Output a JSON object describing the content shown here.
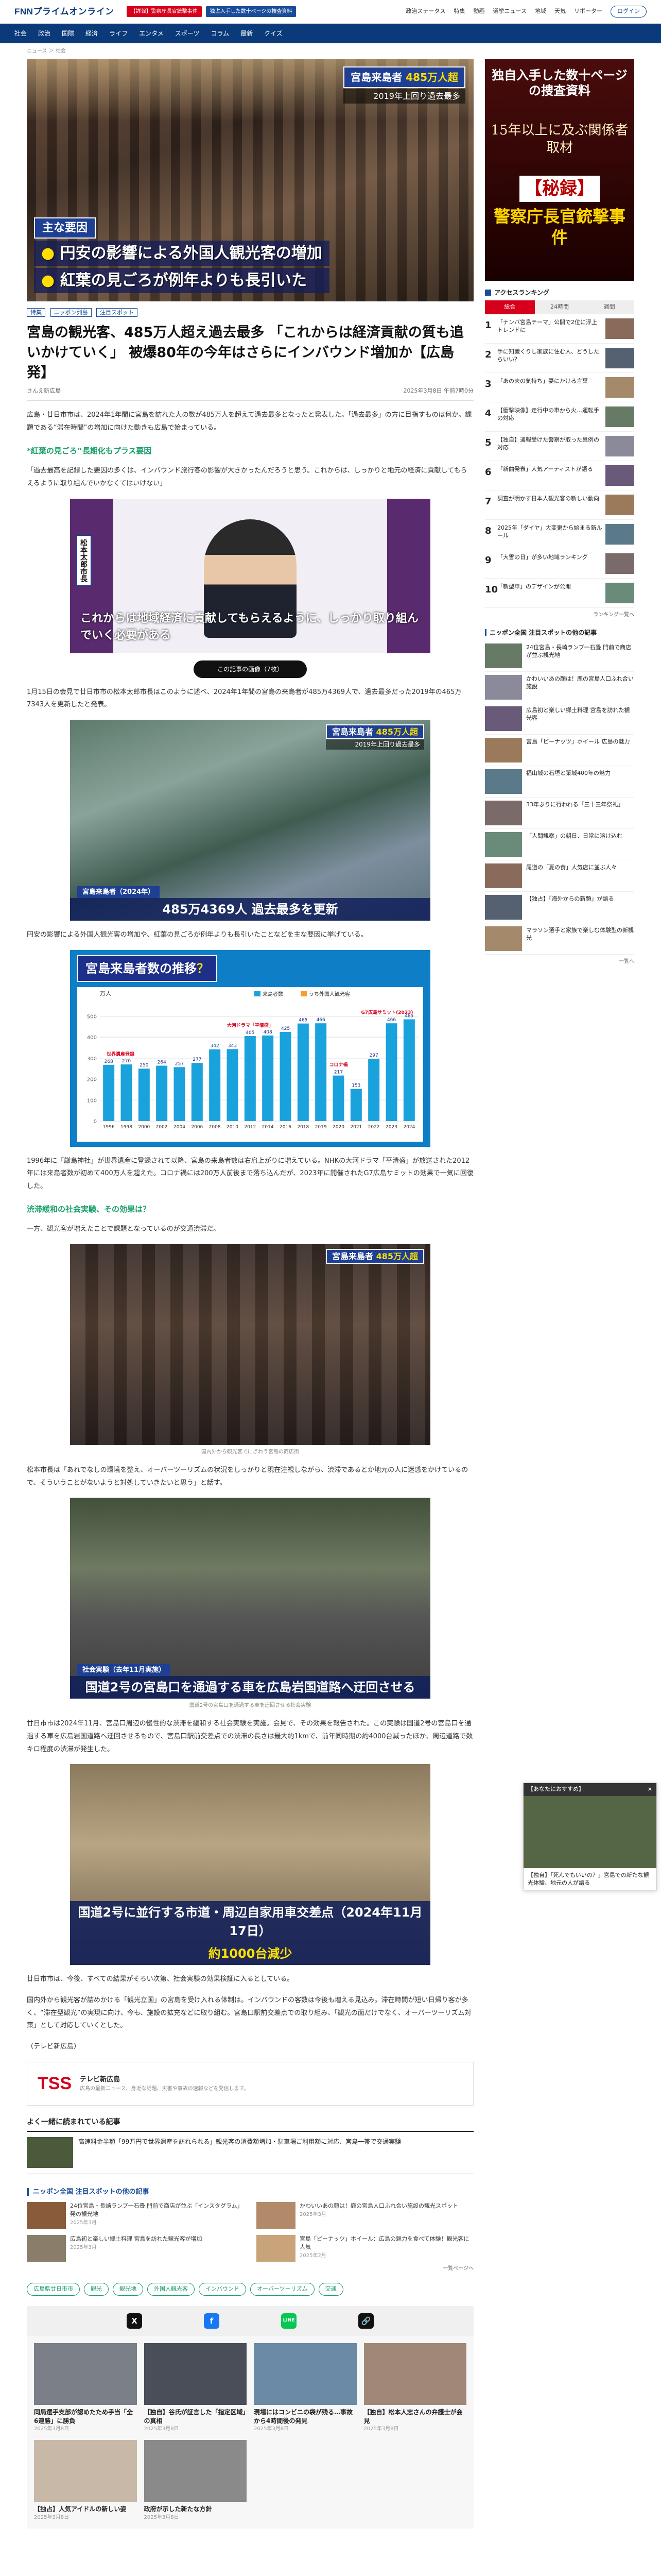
{
  "site": {
    "logo": "FNNプライムオンライン"
  },
  "header": {
    "promos": [
      "【詳報】警察庁長官銃撃事件",
      "独占入手した数十ページの捜査資料"
    ],
    "nav": [
      "政治ステータス",
      "特集",
      "動画",
      "選挙ニュース",
      "地域",
      "天気",
      "リポーター"
    ],
    "login": "ログイン"
  },
  "global_nav": [
    "社会",
    "政治",
    "国際",
    "経済",
    "ライフ",
    "エンタメ",
    "スポーツ",
    "コラム",
    "最新",
    "クイズ"
  ],
  "breadcrumb": "ニュース ＞ 社会",
  "hero": {
    "ch_tag": "宮島来島者",
    "ch_tag_em": "485万人超",
    "ch_tag_sub": "2019年上回り過去最多",
    "factor_label": "主な要因",
    "factors": [
      "円安の影響による外国人観光客の増加",
      "紅葉の見ごろが例年よりも長引いた"
    ]
  },
  "article": {
    "labels": [
      "特集",
      "ニッポン列島",
      "注目スポット"
    ],
    "title": "宮島の観光客、485万人超え過去最多 「これからは経済貢献の質も追いかけていく」 被爆80年の今年はさらにインバウンド増加か【広島発】",
    "author": "さんえ新広島",
    "date": "2025年3月8日 午前7時0分",
    "p1": "広島・廿日市市は、2024年1年間に宮島を訪れた人の数が485万人を超えて過去最多となったと発表した。「過去最多」の方に目指すものは何か。課題である“滞在時間”の増加に向けた動きも広島で始まっている。",
    "sub1": "*紅葉の見ごろ“長期化もプラス要因",
    "p2": "「過去最高を記録した要因の多くは、インバウンド旅行客の影響が大きかったんだろうと思う。これからは、しっかりと地元の経済に貢献してもらえるように取り組んでいかなくてはいけない」",
    "mayor_name": "松本太郎市長",
    "mayor_quote": "これからは地域経済に貢献してもらえるように、しっかり取り組んでいく必要がある",
    "photo_count": "この記事の画像（7枚）",
    "p3": "1月15日の会見で廿日市市の松本太郎市長はこのように述べ、2024年1年間の宮島の来島者が485万4369人で、過去最多だった2019年の465万7343人を更新したと発表。",
    "aerial_tag": "宮島来島者",
    "aerial_tag_em": "485万人超",
    "aerial_sub": "2019年上回り過去最多",
    "aerial_low_tag": "宮島来島者（2024年）",
    "aerial_low": "485万4369人 過去最多を更新",
    "p4": "円安の影響による外国人観光客の増加や、紅葉の見ごろが例年よりも長引いたことなどを主な要因に挙げている。",
    "p5": "1996年に「厳島神社」が世界遺産に登録されて以降、宮島の来島者数は右肩上がりに増えている。NHKの大河ドラマ「平清盛」が放送された2012年には来島者数が初めて400万人を超えた。コロナ禍には200万人前後まで落ち込んだが、2023年に開催されたG7広島サミットの効果で一気に回復した。",
    "sub2": "渋滞緩和の社会実験、その効果は？",
    "p6": "一方、観光客が増えたことで課題となっているのが交通渋滞だ。",
    "crowd_cap": "国内外から観光客でにぎわう宮島の商店街",
    "p7": "松本市長は「あれでなしの環境を整え、オーバーツーリズムの状況をしっかりと現在注視しながら、渋滞であるとか地元の人に迷惑をかけているので、そういうことがないようと対処していきたいと思う」と話す。",
    "road_tag": "社会実験",
    "road_tag_sub": "（去年11月実施）",
    "road_low": "国道2号の宮島口を通過する車を広島岩国道路へ迂回させる",
    "road_cap": "国道2号の宮島口を通過する車を迂回させる社会実験",
    "p8": "廿日市市は2024年11月、宮島口周辺の慢性的な渋滞を緩和する社会実験を実施。会見で、その効果を報告された。この実験は国道2号の宮島口を通過する車を広島岩国道路へ迂回させるもので、宮島口駅前交差点での渋滞の長さは最大約1kmで、前年同時期の約4000台減ったほか、周辺道路で数キロ程度の渋滞が発生した。",
    "survey_low": "国道2号に並行する市道・周辺自家用車交差点（2024年11月17日）",
    "survey_low2": "約1000台減少",
    "p9": "廿日市市は、今後、すべての結果がそろい次第、社会実験の効果検証に入るとしている。",
    "p10": "国内外から観光客が詰めかける「観光立国」の宮島を受け入れる体制は。インバウンドの客数は今後も増える見込み。滞在時間が短い日帰り客が多く、“滞在型観光”の実現に向け、今も、施設の拡充などに取り組む。宮島口駅前交差点での取り組み、「観光の面だけでなく、オーバーツーリズム対策」として対応していくとした。",
    "source": "（テレビ新広島）"
  },
  "chart_data": {
    "type": "bar",
    "title": "宮島来島者数の推移",
    "title_em": "？",
    "legend": [
      "来島者数",
      "うち外国人観光客"
    ],
    "categories": [
      "1996",
      "1998",
      "2000",
      "2002",
      "2004",
      "2006",
      "2008",
      "2010",
      "2012",
      "2014",
      "2016",
      "2018",
      "2019",
      "2020",
      "2021",
      "2022",
      "2023",
      "2024"
    ],
    "values": [
      268,
      270,
      250,
      264,
      257,
      277,
      342,
      343,
      405,
      408,
      425,
      465,
      466,
      217,
      153,
      297,
      466,
      485
    ],
    "annotations": [
      {
        "label": "世界遺産登録",
        "x": "1996"
      },
      {
        "label": "大河ドラマ「平清盛」",
        "x": "2012"
      },
      {
        "label": "コロナ禍",
        "x": "2020"
      },
      {
        "label": "G7広島サミット(2023)",
        "x": "2023"
      }
    ],
    "ylim": [
      0,
      550
    ],
    "ylabel": "万人"
  },
  "tss": {
    "logo": "TSS",
    "name": "テレビ新広島",
    "desc": "広島の最新ニュース、身近な話題、災害や事故の速報などを発信します。"
  },
  "read_more": {
    "heading": "よく一緒に読まれている記事",
    "item": "高速料金半額「99万円で世界遺産を訪れられる」観光客の消費額増加・駐車場ご利用額に対応、宮島一帯で交通実験"
  },
  "gn_section": {
    "heading": "ニッポン全国 注目スポットの他の記事",
    "items": [
      {
        "title": "24位宮島・長崎ランプ一石畳 門前で商店が並ぶ「インスタグラム」発の観光地",
        "date": "2025年3月"
      },
      {
        "title": "かわいいあの顔は！鹿の宮島人口ふれ合い施設の観光スポット",
        "date": "2025年3月"
      },
      {
        "title": "広島初と楽しい郷土料理 宮島を訪れた観光客が増加",
        "date": "2025年3月"
      },
      {
        "title": "宮島「ピーナッツ」ホイール：広島の魅力を食べて体験！観光客に人気",
        "date": "2025年2月"
      }
    ],
    "more": "一覧ページへ"
  },
  "tags": [
    "広島県廿日市市",
    "観光",
    "観光地",
    "外国人観光客",
    "インバウンド",
    "オーバーツーリズム",
    "交通"
  ],
  "share": [
    "X",
    "f",
    "LINE",
    "🔗"
  ],
  "bottom": [
    {
      "title": "同局選手支部が認めたため手当「全6連勝」に勝負",
      "date": "2025年3月8日"
    },
    {
      "title": "【独自】谷氏が証言した「指定区域」の真相",
      "date": "2025年3月8日"
    },
    {
      "title": "現場にはコンビニの袋が残る…事故から4時間後の発見",
      "date": "2025年3月8日"
    },
    {
      "title": "【独自】松本人志さんの弁護士が会見",
      "date": "2025年3月8日"
    },
    {
      "title": "【独占】人気アイドルの新しい姿",
      "date": "2025年3月8日"
    },
    {
      "title": "政府が示した新たな方針",
      "date": "2025年3月8日"
    }
  ],
  "sidebar": {
    "ad": {
      "a1": "独自入手した数十ページの捜査資料",
      "a2": "15年以上に及ぶ関係者取材",
      "a3": "【秘録】",
      "a4": "警察庁長官銃撃事件"
    },
    "rank_head": "アクセスランキング",
    "tabs": [
      "総合",
      "24時間",
      "週間"
    ],
    "ranks": [
      "「ナンバ宮島テーマ」公開で2位に浮上 トレンドに",
      "手に知識くりし家族に住む人、どうしたらいい？",
      "「あの夫の気持ち」妻にかける言葉",
      "【衝撃映像】走行中の車から火…運転手の対応",
      "【独自】通報受けた警察が取った異例の対応",
      "「新曲発表」人気アーティストが語る",
      "調査が明かす日本人観光客の新しい動向",
      "2025年「ダイヤ」大変更から始まる新ルール",
      "「大雪の日」が多い地域ランキング",
      "「新型車」のデザインが公開"
    ],
    "rank_more": "ランキング一覧へ",
    "gn_head": "ニッポン全国 注目スポットの他の記事",
    "gn_items": [
      "24位宮島・長崎ランプ一石畳 門前で商店が並ぶ観光地",
      "かわいいあの顔は！鹿の宮島人口ふれ合い施設",
      "広島初と楽しい郷土料理 宮島を訪れた観光客",
      "宮島「ピーナッツ」ホイール 広島の魅力",
      "福山城の石垣と築城400年の魅力",
      "33年ぶりに行われる「三十三年祭礼」",
      "「人間観察」の朝日、日常に溶け込む",
      "尾道の「夏の食」人気店に並ぶ人々",
      "【独占】「海外からの新顔」が語る",
      "マラソン選手と家族で楽しむ体験型の新観光"
    ],
    "gn_more": "一覧へ"
  },
  "floating": {
    "label": "【あなたにおすすめ】",
    "close": "×",
    "title": "【独自】「死んでもいいの？」宮島での新たな観光体験、地元の人が語る"
  }
}
